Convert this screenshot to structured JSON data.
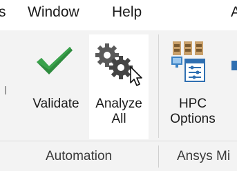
{
  "menubar": {
    "items": [
      {
        "label": "s"
      },
      {
        "label": "Window"
      },
      {
        "label": "Help"
      },
      {
        "label": "A"
      }
    ]
  },
  "ribbon": {
    "buttons": [
      {
        "label_line1": "Validate",
        "label_line2": "",
        "icon": "checkmark-icon"
      },
      {
        "label_line1": "Analyze",
        "label_line2": "All",
        "icon": "gears-icon"
      },
      {
        "label_line1": "HPC",
        "label_line2": "Options",
        "icon": "hpc-icon"
      }
    ]
  },
  "groups": [
    {
      "label": "Automation"
    },
    {
      "label": "Ansys Mi"
    }
  ],
  "colors": {
    "check_green": "#2e8b3e",
    "gear_gray": "#555555",
    "ribbon_bg": "#f3f3f3",
    "hover_bg": "#ffffff"
  }
}
